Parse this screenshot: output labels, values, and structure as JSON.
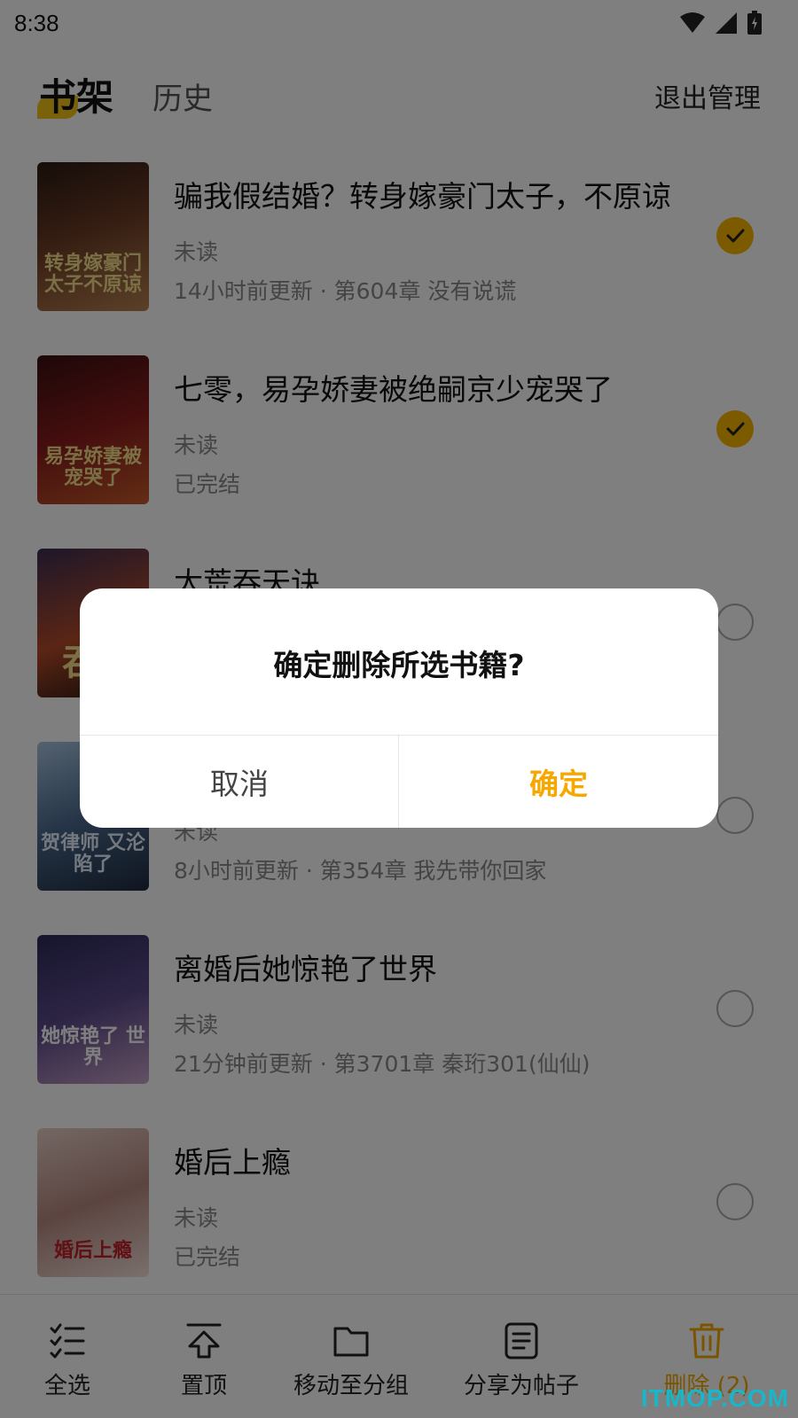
{
  "status_bar": {
    "time": "8:38"
  },
  "header": {
    "tabs": [
      {
        "label": "书架"
      },
      {
        "label": "历史"
      }
    ],
    "exit_manage_label": "退出管理"
  },
  "books": [
    {
      "title": "骗我假结婚？转身嫁豪门太子，不原谅",
      "status": "未读",
      "update": "14小时前更新 · 第604章 没有说谎",
      "selected": true,
      "cover_text": "转身嫁豪门 太子不原谅"
    },
    {
      "title": "七零，易孕娇妻被绝嗣京少宠哭了",
      "status": "未读",
      "update": "已完结",
      "selected": true,
      "cover_text": "易孕娇妻被 宠哭了"
    },
    {
      "title": "太荒吞天诀",
      "status": "",
      "update": "",
      "selected": false,
      "cover_text": "吞"
    },
    {
      "title": "",
      "status": "未读",
      "update": "8小时前更新 · 第354章  我先带你回家",
      "selected": false,
      "cover_text": "贺律师 又沦陷了"
    },
    {
      "title": "离婚后她惊艳了世界",
      "status": "未读",
      "update": "21分钟前更新 · 第3701章  秦珩301(仙仙)",
      "selected": false,
      "cover_text": "她惊艳了 世界"
    },
    {
      "title": "婚后上瘾",
      "status": "未读",
      "update": "已完结",
      "selected": false,
      "cover_text": "婚后上瘾"
    }
  ],
  "bottom_bar": {
    "select_all": "全选",
    "pin_top": "置顶",
    "move_group": "移动至分组",
    "share_post": "分享为帖子",
    "delete": "删除 (2)"
  },
  "dialog": {
    "title": "确定删除所选书籍?",
    "cancel": "取消",
    "confirm": "确定"
  },
  "watermark": "ITMOP.COM",
  "colors": {
    "accent": "#f7b500",
    "confirm": "#f7a800",
    "watermark": "#17b6c8"
  }
}
